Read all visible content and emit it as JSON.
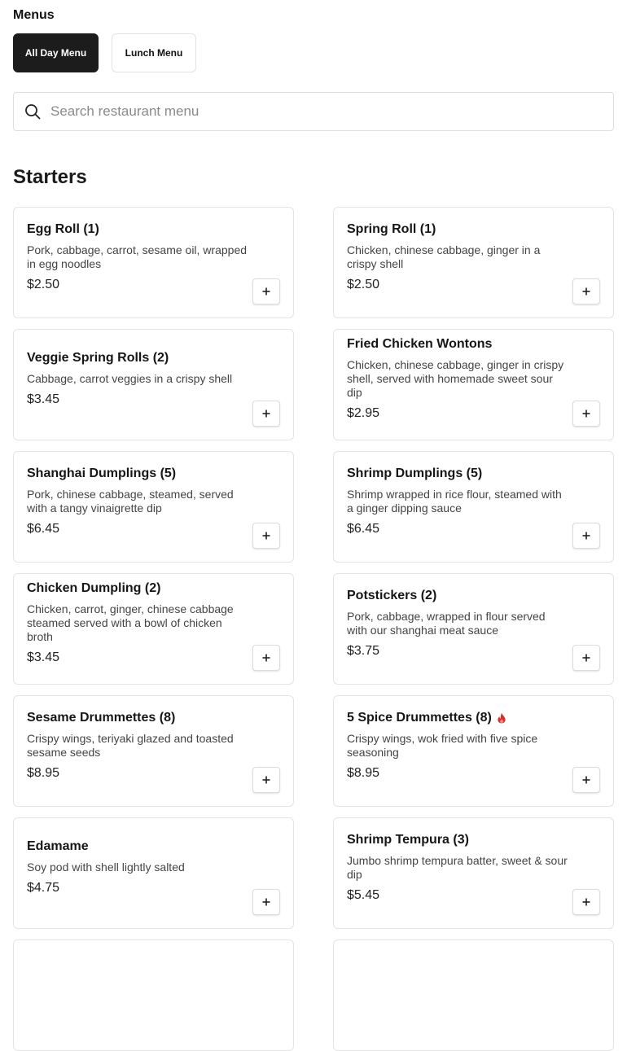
{
  "page": {
    "menus_label": "Menus",
    "tabs": [
      {
        "label": "All Day Menu",
        "active": true
      },
      {
        "label": "Lunch Menu",
        "active": false
      }
    ],
    "search": {
      "placeholder": "Search restaurant menu",
      "value": ""
    },
    "section_title": "Starters"
  },
  "items": [
    {
      "name": "Egg Roll (1)",
      "description": "Pork, cabbage, carrot, sesame oil, wrapped in egg noodles",
      "price": "$2.50",
      "spicy": false
    },
    {
      "name": "Spring Roll (1)",
      "description": "Chicken, chinese cabbage, ginger in a crispy shell",
      "price": "$2.50",
      "spicy": false
    },
    {
      "name": "Veggie Spring Rolls (2)",
      "description": "Cabbage, carrot veggies in a crispy shell",
      "price": "$3.45",
      "spicy": false
    },
    {
      "name": "Fried Chicken Wontons",
      "description": "Chicken, chinese cabbage, ginger in crispy shell, served with homemade sweet sour dip",
      "price": "$2.95",
      "spicy": false
    },
    {
      "name": "Shanghai Dumplings (5)",
      "description": "Pork, chinese cabbage, steamed, served with a tangy vinaigrette dip",
      "price": "$6.45",
      "spicy": false
    },
    {
      "name": "Shrimp Dumplings (5)",
      "description": "Shrimp wrapped in rice flour, steamed with a ginger dipping sauce",
      "price": "$6.45",
      "spicy": false
    },
    {
      "name": "Chicken Dumpling (2)",
      "description": "Chicken, carrot, ginger, chinese cabbage steamed served with a bowl of chicken broth",
      "price": "$3.45",
      "spicy": false
    },
    {
      "name": "Potstickers (2)",
      "description": "Pork, cabbage, wrapped in flour served with our shanghai meat sauce",
      "price": "$3.75",
      "spicy": false
    },
    {
      "name": "Sesame Drummettes (8)",
      "description": "Crispy wings, teriyaki glazed and toasted sesame seeds",
      "price": "$8.95",
      "spicy": false
    },
    {
      "name": "5 Spice Drummettes (8)",
      "description": "Crispy wings, wok fried with five spice seasoning",
      "price": "$8.95",
      "spicy": true
    },
    {
      "name": "Edamame",
      "description": "Soy pod with shell lightly salted",
      "price": "$4.75",
      "spicy": false
    },
    {
      "name": "Shrimp Tempura (3)",
      "description": "Jumbo shrimp tempura batter, sweet & sour dip",
      "price": "$5.45",
      "spicy": false
    },
    {
      "name": "",
      "description": "",
      "price": "",
      "spicy": false
    },
    {
      "name": "",
      "description": "",
      "price": "",
      "spicy": false
    }
  ],
  "icons": {
    "search": "search-icon",
    "add": "plus-icon",
    "spicy": "flame-icon"
  },
  "colors": {
    "active_tab": "#1c1c1c",
    "spicy": "#d32f2f"
  }
}
